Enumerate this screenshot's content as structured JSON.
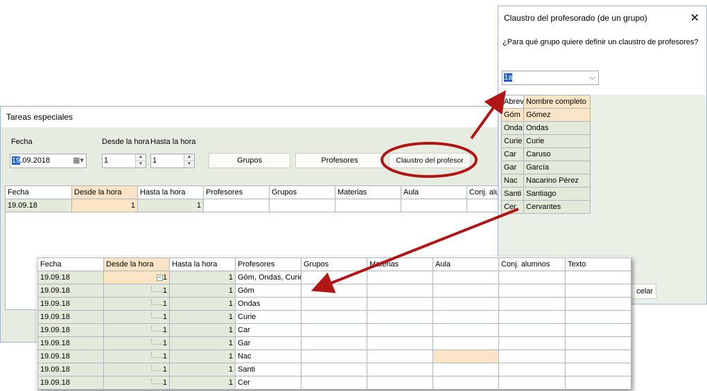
{
  "main_window": {
    "title": "Tareas especiales",
    "labels": {
      "fecha": "Fecha",
      "desde": "Desde la hora",
      "hasta": "Hasta la hora"
    },
    "date_value": "19.09.2018",
    "date_selected": "19",
    "date_rest": ".09.2018",
    "desde_value": "1",
    "hasta_value": "1",
    "buttons": {
      "grupos": "Grupos",
      "profesores": "Profesores",
      "claustro": "Claustro  del  profesor"
    },
    "table": {
      "columns": [
        "Fecha",
        "Desde la hora",
        "Hasta la hora",
        "Profesores",
        "Grupos",
        "Materias",
        "Aula",
        "Conj. alumn"
      ],
      "row": [
        "19.09.18",
        "1",
        "1",
        "",
        "",
        "",
        "",
        ""
      ]
    }
  },
  "dialog": {
    "title": "Claustro del profesorado (de un grupo)",
    "question": "¿Para qué grupo quiere definir un claustro de profesores?",
    "selected_group": "1a",
    "cancel_partial": "celar",
    "columns": [
      "Abrev",
      "Nombre completo"
    ],
    "teachers": [
      [
        "Góm",
        "Gómez"
      ],
      [
        "Onda",
        "Ondas"
      ],
      [
        "Curie",
        "Curie"
      ],
      [
        "Car",
        "Caruso"
      ],
      [
        "Gar",
        "García"
      ],
      [
        "Nac",
        "Nacarino Pérez"
      ],
      [
        "Santi",
        "Santiago"
      ],
      [
        "Cer",
        "Cervantes"
      ]
    ]
  },
  "result_table": {
    "columns": [
      "Fecha",
      "Desde la hora",
      "Hasta la hora",
      "Profesores",
      "Grupos",
      "Materias",
      "Aula",
      "Conj. alumnos",
      "Texto"
    ],
    "rows": [
      [
        "19.09.18",
        "1",
        "1",
        "Góm, Ondas, Curie"
      ],
      [
        "19.09.18",
        "1",
        "1",
        "Góm"
      ],
      [
        "19.09.18",
        "1",
        "1",
        "Ondas"
      ],
      [
        "19.09.18",
        "1",
        "1",
        "Curie"
      ],
      [
        "19.09.18",
        "1",
        "1",
        "Car"
      ],
      [
        "19.09.18",
        "1",
        "1",
        "Gar"
      ],
      [
        "19.09.18",
        "1",
        "1",
        "Nac"
      ],
      [
        "19.09.18",
        "1",
        "1",
        "Santi"
      ],
      [
        "19.09.18",
        "1",
        "1",
        "Cer"
      ]
    ]
  },
  "colors": {
    "annotation": "#b01616",
    "highlight": "#fbe4c6",
    "window_bg": "#e6ecdf",
    "selection": "#1a5fd0"
  }
}
